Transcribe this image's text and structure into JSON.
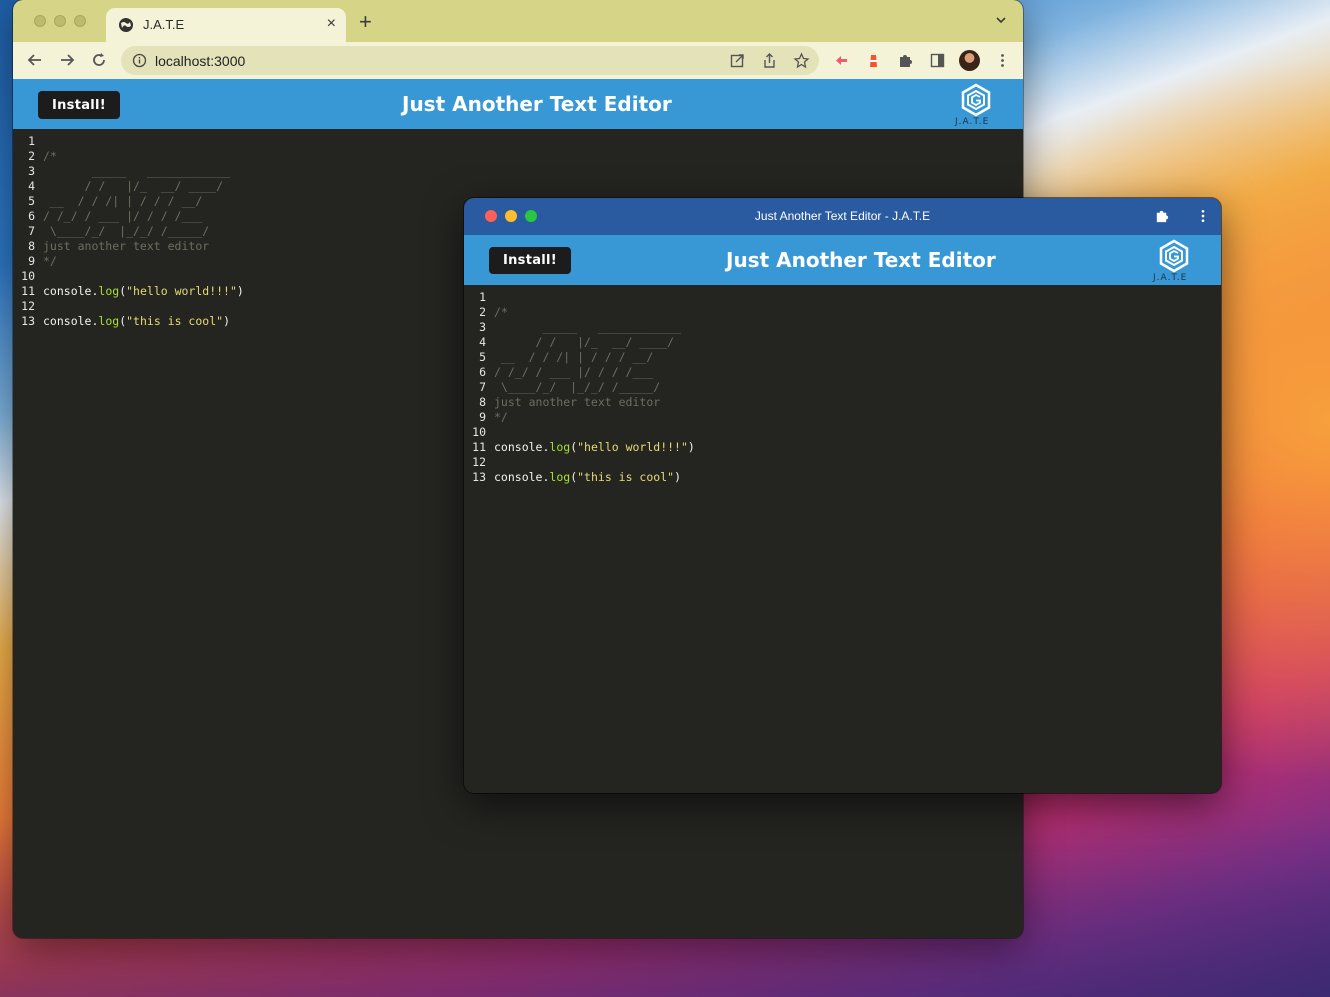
{
  "browser": {
    "tab_title": "J.A.T.E",
    "tab_close": "×",
    "new_tab": "+",
    "url": "localhost:3000"
  },
  "app": {
    "install_label": "Install!",
    "title": "Just Another Text Editor",
    "logo_text": "J.A.T.E"
  },
  "pwa": {
    "window_title": "Just Another Text Editor - J.A.T.E"
  },
  "editor": {
    "line_numbers": [
      "1",
      "2",
      "3",
      "4",
      "5",
      "6",
      "7",
      "8",
      "9",
      "10",
      "11",
      "12",
      "13"
    ],
    "ascii": [
      "/*",
      "       _____   ____________",
      "      / /   |/_  __/ ____/",
      " __  / / /| | / / / __/",
      "/ /_/ / ___ |/ / / /___",
      " \\____/_/  |_/_/ /_____/",
      "just another text editor",
      "*/"
    ],
    "log1": {
      "obj": "console",
      "dot": ".",
      "fn": "log",
      "open": "(",
      "str": "\"hello world!!!\"",
      "close": ")"
    },
    "log2": {
      "obj": "console",
      "dot": ".",
      "fn": "log",
      "open": "(",
      "str": "\"this is cool\"",
      "close": ")"
    }
  },
  "colors": {
    "header_blue": "#3898d6",
    "pwa_titlebar": "#2a5aa0",
    "tabstrip": "#d6d486",
    "editor_bg": "#242421"
  }
}
